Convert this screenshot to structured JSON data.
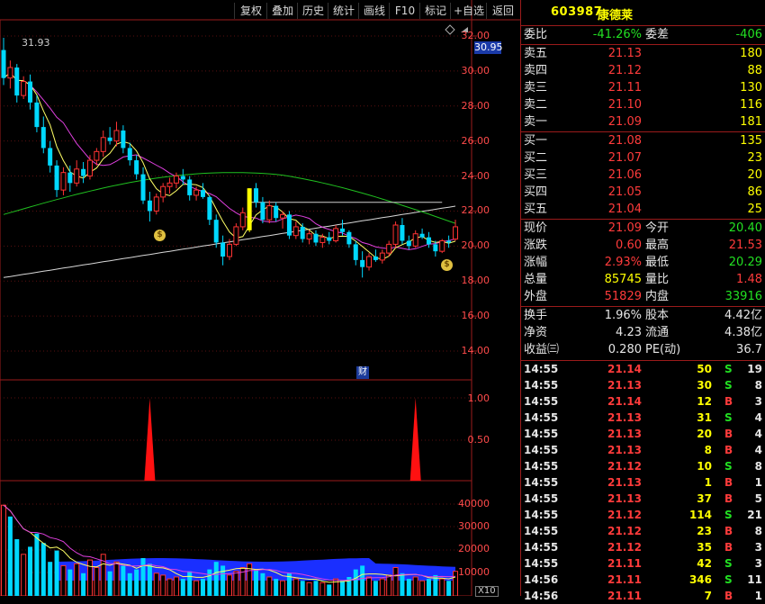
{
  "toolbar": {
    "buttons": [
      "复权",
      "叠加",
      "历史",
      "统计",
      "画线",
      "F10",
      "标记",
      "+自选",
      "返回"
    ]
  },
  "stock": {
    "code": "603987",
    "name": "康德莱"
  },
  "main_axis": {
    "ticks": [
      "32.00",
      "30.00",
      "28.00",
      "26.00",
      "24.00",
      "22.00",
      "20.00",
      "18.00",
      "16.00",
      "14.00"
    ],
    "current_price": "30.95",
    "high_label": "31.93"
  },
  "mid_axis": {
    "ticks": [
      "1.00",
      "0.50"
    ]
  },
  "vol_axis": {
    "ticks": [
      "40000",
      "30000",
      "20000",
      "10000"
    ],
    "unit": "X10"
  },
  "finance_marker": "财",
  "coin_icon": "$",
  "order_book": {
    "weibi_label": "委比",
    "weibi_value": "-41.26%",
    "weicha_label": "委差",
    "weicha_value": "-406",
    "asks": [
      {
        "label": "卖五",
        "price": "21.13",
        "vol": "180"
      },
      {
        "label": "卖四",
        "price": "21.12",
        "vol": "88"
      },
      {
        "label": "卖三",
        "price": "21.11",
        "vol": "130"
      },
      {
        "label": "卖二",
        "price": "21.10",
        "vol": "116"
      },
      {
        "label": "卖一",
        "price": "21.09",
        "vol": "181"
      }
    ],
    "bids": [
      {
        "label": "买一",
        "price": "21.08",
        "vol": "135"
      },
      {
        "label": "买二",
        "price": "21.07",
        "vol": "23"
      },
      {
        "label": "买三",
        "price": "21.06",
        "vol": "20"
      },
      {
        "label": "买四",
        "price": "21.05",
        "vol": "86"
      },
      {
        "label": "买五",
        "price": "21.04",
        "vol": "25"
      }
    ]
  },
  "quote": [
    {
      "l1": "现价",
      "v1": "21.09",
      "c1": "red",
      "l2": "今开",
      "v2": "20.40",
      "c2": "grn"
    },
    {
      "l1": "涨跌",
      "v1": "0.60",
      "c1": "red",
      "l2": "最高",
      "v2": "21.53",
      "c2": "red"
    },
    {
      "l1": "涨幅",
      "v1": "2.93%",
      "c1": "red",
      "l2": "最低",
      "v2": "20.29",
      "c2": "grn"
    },
    {
      "l1": "总量",
      "v1": "85745",
      "c1": "yel",
      "l2": "量比",
      "v2": "1.48",
      "c2": "red"
    },
    {
      "l1": "外盘",
      "v1": "51829",
      "c1": "red",
      "l2": "内盘",
      "v2": "33916",
      "c2": "grn"
    }
  ],
  "finance": [
    {
      "l1": "换手",
      "v1": "1.96%",
      "l2": "股本",
      "v2": "4.42亿"
    },
    {
      "l1": "净资",
      "v1": "4.23",
      "l2": "流通",
      "v2": "4.38亿"
    },
    {
      "l1": "收益㈢",
      "v1": "0.280",
      "l2": "PE(动)",
      "v2": "36.7"
    }
  ],
  "ticks": [
    {
      "time": "14:55",
      "price": "21.14",
      "vol": "50",
      "side": "S",
      "n": "19"
    },
    {
      "time": "14:55",
      "price": "21.13",
      "vol": "30",
      "side": "S",
      "n": "8"
    },
    {
      "time": "14:55",
      "price": "21.14",
      "vol": "12",
      "side": "B",
      "n": "3"
    },
    {
      "time": "14:55",
      "price": "21.13",
      "vol": "31",
      "side": "S",
      "n": "4"
    },
    {
      "time": "14:55",
      "price": "21.13",
      "vol": "20",
      "side": "B",
      "n": "4"
    },
    {
      "time": "14:55",
      "price": "21.13",
      "vol": "8",
      "side": "B",
      "n": "4"
    },
    {
      "time": "14:55",
      "price": "21.12",
      "vol": "10",
      "side": "S",
      "n": "8"
    },
    {
      "time": "14:55",
      "price": "21.13",
      "vol": "1",
      "side": "B",
      "n": "1"
    },
    {
      "time": "14:55",
      "price": "21.13",
      "vol": "37",
      "side": "B",
      "n": "5"
    },
    {
      "time": "14:55",
      "price": "21.12",
      "vol": "114",
      "side": "S",
      "n": "21"
    },
    {
      "time": "14:55",
      "price": "21.12",
      "vol": "23",
      "side": "B",
      "n": "8"
    },
    {
      "time": "14:55",
      "price": "21.12",
      "vol": "35",
      "side": "B",
      "n": "3"
    },
    {
      "time": "14:55",
      "price": "21.11",
      "vol": "42",
      "side": "S",
      "n": "3"
    },
    {
      "time": "14:56",
      "price": "21.11",
      "vol": "346",
      "side": "S",
      "n": "11"
    },
    {
      "time": "14:56",
      "price": "21.11",
      "vol": "7",
      "side": "B",
      "n": "1"
    }
  ],
  "chart_data": {
    "type": "candlestick",
    "ylim": [
      13.5,
      32.5
    ],
    "candles": [
      [
        31.2,
        31.9,
        29.2,
        29.6
      ],
      [
        29.6,
        30.6,
        29.0,
        30.2
      ],
      [
        30.2,
        30.4,
        28.2,
        28.6
      ],
      [
        28.6,
        29.7,
        28.4,
        29.4
      ],
      [
        29.4,
        29.8,
        27.8,
        28.2
      ],
      [
        28.2,
        28.6,
        26.5,
        26.8
      ],
      [
        26.8,
        27.4,
        25.3,
        25.6
      ],
      [
        25.6,
        26.0,
        24.2,
        24.6
      ],
      [
        24.6,
        24.9,
        22.8,
        23.2
      ],
      [
        23.2,
        24.5,
        22.9,
        24.2
      ],
      [
        24.2,
        24.6,
        23.1,
        23.6
      ],
      [
        23.6,
        24.9,
        23.4,
        24.4
      ],
      [
        24.4,
        24.8,
        23.6,
        24.0
      ],
      [
        24.0,
        25.2,
        23.8,
        24.9
      ],
      [
        24.9,
        25.6,
        24.6,
        25.4
      ],
      [
        25.4,
        26.6,
        25.1,
        26.2
      ],
      [
        26.2,
        26.8,
        25.8,
        26.0
      ],
      [
        26.0,
        27.1,
        25.7,
        26.6
      ],
      [
        26.6,
        26.9,
        25.3,
        25.6
      ],
      [
        25.6,
        25.9,
        24.6,
        24.9
      ],
      [
        24.9,
        25.2,
        23.8,
        24.1
      ],
      [
        24.1,
        24.5,
        22.4,
        22.6
      ],
      [
        22.6,
        23.1,
        21.4,
        22.0
      ],
      [
        22.0,
        23.0,
        21.8,
        22.8
      ],
      [
        22.8,
        23.6,
        22.5,
        23.4
      ],
      [
        23.4,
        23.9,
        23.0,
        23.6
      ],
      [
        23.6,
        24.2,
        23.3,
        24.0
      ],
      [
        24.0,
        24.4,
        23.5,
        23.8
      ],
      [
        23.8,
        24.0,
        22.6,
        22.9
      ],
      [
        22.9,
        23.4,
        22.6,
        23.2
      ],
      [
        23.2,
        23.6,
        22.7,
        22.8
      ],
      [
        22.8,
        22.9,
        21.2,
        21.5
      ],
      [
        21.5,
        21.8,
        19.9,
        20.2
      ],
      [
        20.2,
        20.6,
        18.9,
        19.4
      ],
      [
        19.4,
        20.4,
        19.2,
        20.1
      ],
      [
        20.1,
        21.3,
        20.0,
        21.1
      ],
      [
        21.1,
        22.2,
        20.9,
        21.9
      ],
      [
        20.9,
        23.3,
        20.8,
        23.3
      ],
      [
        23.3,
        23.6,
        22.2,
        22.5
      ],
      [
        22.5,
        22.8,
        21.3,
        21.5
      ],
      [
        21.5,
        22.6,
        21.3,
        22.3
      ],
      [
        22.3,
        22.5,
        21.4,
        21.6
      ],
      [
        21.6,
        22.0,
        21.0,
        21.8
      ],
      [
        21.8,
        22.0,
        20.4,
        20.6
      ],
      [
        20.6,
        21.4,
        20.4,
        21.1
      ],
      [
        21.1,
        21.3,
        20.2,
        20.4
      ],
      [
        20.4,
        20.9,
        20.1,
        20.7
      ],
      [
        20.7,
        20.9,
        20.0,
        20.2
      ],
      [
        20.2,
        20.7,
        19.9,
        20.5
      ],
      [
        20.5,
        20.8,
        20.1,
        20.3
      ],
      [
        20.3,
        21.2,
        20.2,
        21.0
      ],
      [
        21.0,
        21.5,
        20.6,
        20.8
      ],
      [
        20.8,
        20.9,
        19.9,
        20.1
      ],
      [
        20.1,
        20.3,
        18.9,
        19.2
      ],
      [
        19.2,
        19.7,
        18.2,
        18.8
      ],
      [
        18.8,
        19.6,
        18.6,
        19.4
      ],
      [
        19.4,
        19.8,
        19.1,
        19.2
      ],
      [
        19.2,
        19.8,
        19.0,
        19.6
      ],
      [
        19.6,
        20.3,
        19.4,
        20.1
      ],
      [
        20.1,
        21.4,
        19.9,
        21.2
      ],
      [
        21.2,
        21.6,
        20.1,
        20.3
      ],
      [
        20.3,
        20.6,
        19.8,
        20.0
      ],
      [
        20.0,
        20.9,
        19.9,
        20.7
      ],
      [
        20.7,
        21.0,
        20.4,
        20.5
      ],
      [
        20.5,
        20.8,
        19.9,
        20.1
      ],
      [
        20.1,
        20.3,
        19.4,
        19.7
      ],
      [
        19.7,
        20.4,
        19.6,
        20.3
      ],
      [
        20.3,
        20.6,
        19.9,
        20.2
      ],
      [
        20.4,
        21.5,
        20.3,
        21.1
      ]
    ],
    "volumes": [
      [
        48,
        "u"
      ],
      [
        42,
        "d"
      ],
      [
        30,
        "d"
      ],
      [
        22,
        "u"
      ],
      [
        26,
        "d"
      ],
      [
        33,
        "d"
      ],
      [
        28,
        "d"
      ],
      [
        18,
        "d"
      ],
      [
        24,
        "d"
      ],
      [
        16,
        "u"
      ],
      [
        14,
        "d"
      ],
      [
        17,
        "u"
      ],
      [
        12,
        "d"
      ],
      [
        19,
        "u"
      ],
      [
        15,
        "u"
      ],
      [
        22,
        "u"
      ],
      [
        13,
        "d"
      ],
      [
        18,
        "u"
      ],
      [
        16,
        "d"
      ],
      [
        12,
        "d"
      ],
      [
        14,
        "d"
      ],
      [
        20,
        "d"
      ],
      [
        17,
        "d"
      ],
      [
        12,
        "u"
      ],
      [
        11,
        "u"
      ],
      [
        9,
        "u"
      ],
      [
        10,
        "u"
      ],
      [
        9,
        "d"
      ],
      [
        13,
        "d"
      ],
      [
        8,
        "u"
      ],
      [
        9,
        "d"
      ],
      [
        14,
        "d"
      ],
      [
        18,
        "d"
      ],
      [
        16,
        "d"
      ],
      [
        11,
        "u"
      ],
      [
        13,
        "u"
      ],
      [
        15,
        "u"
      ],
      [
        17,
        "u"
      ],
      [
        14,
        "d"
      ],
      [
        12,
        "d"
      ],
      [
        10,
        "u"
      ],
      [
        9,
        "d"
      ],
      [
        8,
        "u"
      ],
      [
        12,
        "d"
      ],
      [
        9,
        "u"
      ],
      [
        8,
        "d"
      ],
      [
        7,
        "u"
      ],
      [
        8,
        "d"
      ],
      [
        7,
        "u"
      ],
      [
        6,
        "d"
      ],
      [
        9,
        "u"
      ],
      [
        8,
        "d"
      ],
      [
        10,
        "d"
      ],
      [
        14,
        "d"
      ],
      [
        16,
        "d"
      ],
      [
        10,
        "u"
      ],
      [
        8,
        "d"
      ],
      [
        9,
        "u"
      ],
      [
        11,
        "u"
      ],
      [
        15,
        "u"
      ],
      [
        12,
        "d"
      ],
      [
        9,
        "d"
      ],
      [
        10,
        "u"
      ],
      [
        8,
        "u"
      ],
      [
        9,
        "d"
      ],
      [
        11,
        "d"
      ],
      [
        9,
        "u"
      ],
      [
        8,
        "d"
      ],
      [
        13,
        "u"
      ]
    ],
    "signals": [
      22,
      62
    ]
  }
}
